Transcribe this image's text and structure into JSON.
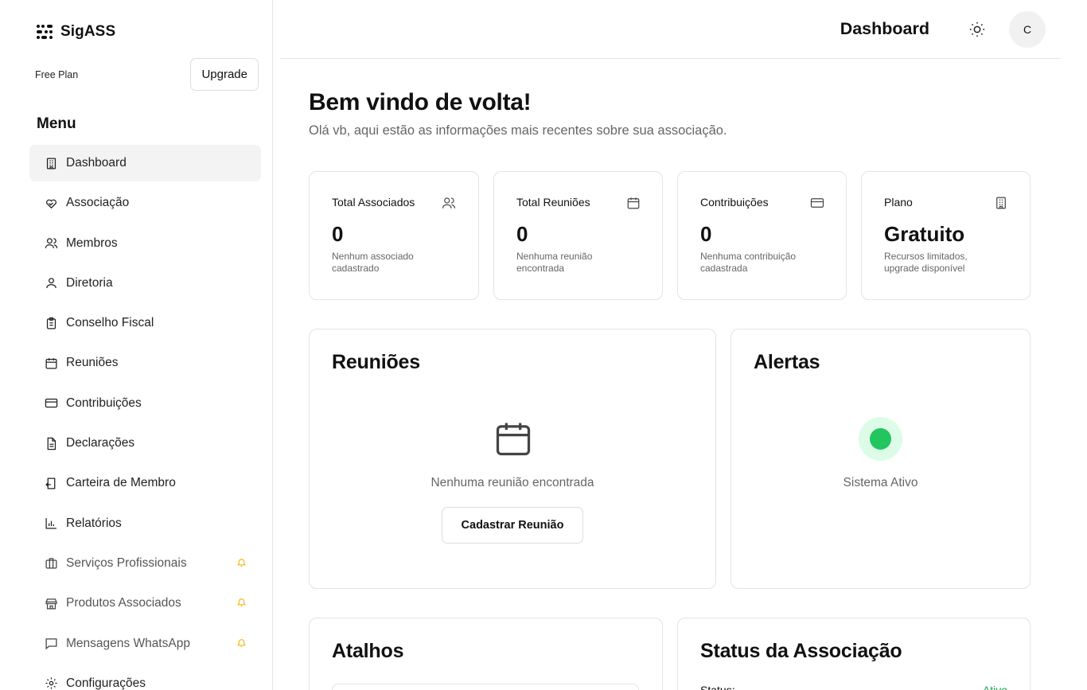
{
  "app": {
    "name": "SigASS"
  },
  "plan": {
    "label": "Free Plan",
    "upgrade_label": "Upgrade"
  },
  "menu": {
    "title": "Menu",
    "items": [
      {
        "label": "Dashboard",
        "icon": "building-icon",
        "active": true
      },
      {
        "label": "Associação",
        "icon": "handshake-icon"
      },
      {
        "label": "Membros",
        "icon": "users-icon"
      },
      {
        "label": "Diretoria",
        "icon": "user-icon"
      },
      {
        "label": "Conselho Fiscal",
        "icon": "clipboard-icon"
      },
      {
        "label": "Reuniões",
        "icon": "calendar-icon"
      },
      {
        "label": "Contribuições",
        "icon": "credit-card-icon"
      },
      {
        "label": "Declarações",
        "icon": "file-text-icon"
      },
      {
        "label": "Carteira de Membro",
        "icon": "id-card-icon"
      },
      {
        "label": "Relatórios",
        "icon": "bar-chart-icon"
      },
      {
        "label": "Serviços Profissionais",
        "icon": "briefcase-icon",
        "badge": "bell-icon"
      },
      {
        "label": "Produtos Associados",
        "icon": "store-icon",
        "badge": "bell-icon"
      },
      {
        "label": "Mensagens WhatsApp",
        "icon": "message-icon",
        "badge": "bell-icon"
      },
      {
        "label": "Configurações",
        "icon": "settings-icon"
      }
    ]
  },
  "header": {
    "title": "Dashboard",
    "avatar_initial": "C"
  },
  "welcome": {
    "title": "Bem vindo de volta!",
    "subtitle": "Olá vb, aqui estão as informações mais recentes sobre sua associação."
  },
  "stats": [
    {
      "title": "Total Associados",
      "value": "0",
      "desc": "Nenhum associado cadastrado",
      "icon": "users-icon"
    },
    {
      "title": "Total Reuniões",
      "value": "0",
      "desc": "Nenhuma reunião encontrada",
      "icon": "calendar-icon"
    },
    {
      "title": "Contribuições",
      "value": "0",
      "desc": "Nenhuma contribuição cadastrada",
      "icon": "credit-card-icon"
    },
    {
      "title": "Plano",
      "value": "Gratuito",
      "desc": "Recursos limitados, upgrade disponível",
      "icon": "building-icon"
    }
  ],
  "reunioes": {
    "title": "Reuniões",
    "empty_text": "Nenhuma reunião encontrada",
    "button_label": "Cadastrar Reunião"
  },
  "alertas": {
    "title": "Alertas",
    "status_text": "Sistema Ativo",
    "status_color": "#22c55e"
  },
  "atalhos": {
    "title": "Atalhos"
  },
  "status_associacao": {
    "title": "Status da Associação",
    "row_label": "Status:",
    "row_value": "Ativo"
  },
  "colors": {
    "accent_green": "#22c55e",
    "border": "#e3e3e3",
    "muted_text": "#666666"
  }
}
